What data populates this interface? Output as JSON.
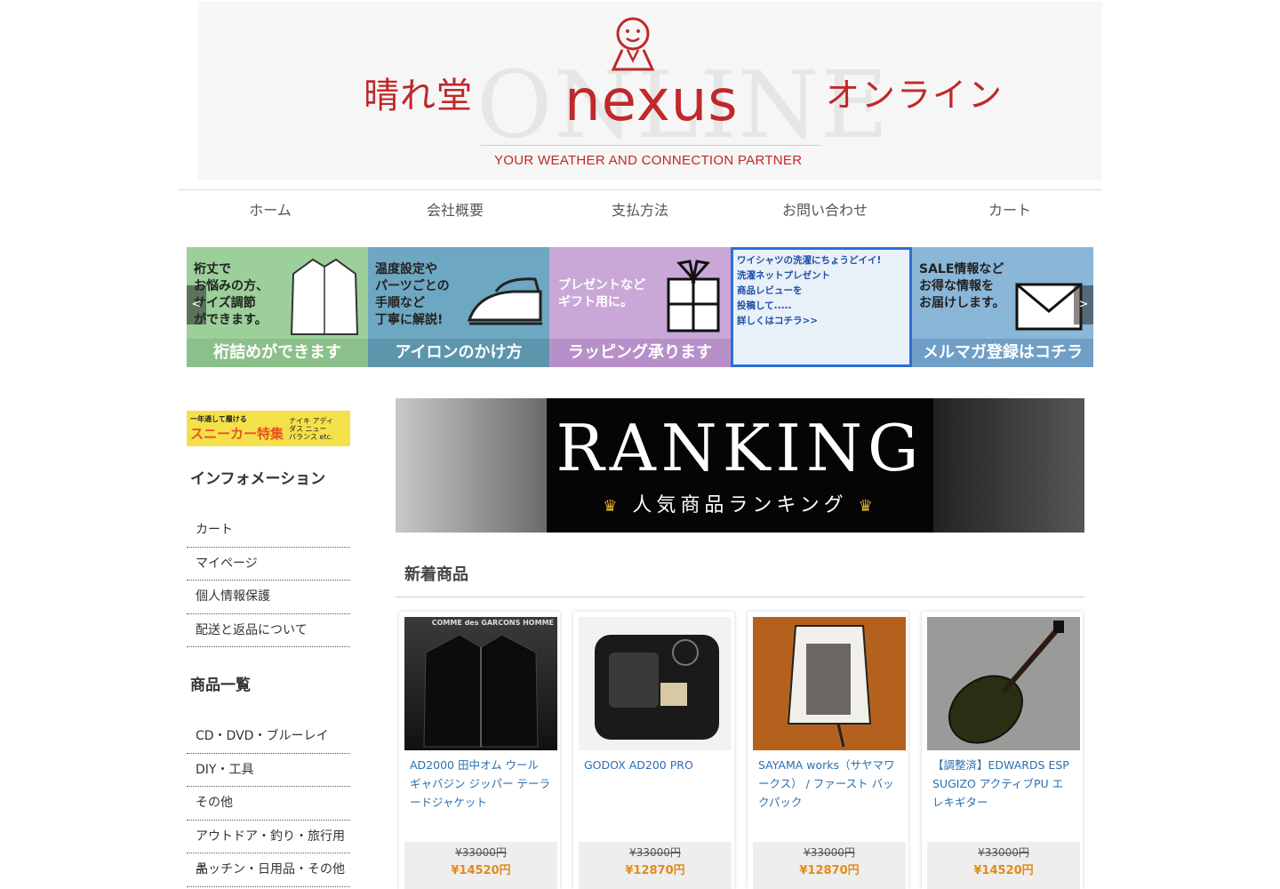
{
  "header": {
    "brand_left": "晴れ堂",
    "brand_main": "nexus",
    "brand_right": "オンライン",
    "ghost_text": "ONLINE",
    "tagline": "YOUR WEATHER AND CONNECTION PARTNER"
  },
  "nav": [
    "ホーム",
    "会社概要",
    "支払方法",
    "お問い合わせ",
    "カート"
  ],
  "carousel": [
    {
      "text": "裄丈で\nお悩みの方、\nサイズ調節\nができます。",
      "caption": "裄詰めができます"
    },
    {
      "text": "温度設定や\nパーツごとの\n手順など\n丁寧に解説!",
      "caption": "アイロンのかけ方"
    },
    {
      "text": "プレゼントなど\nギフト用に。",
      "caption": "ラッピング承ります"
    },
    {
      "text": "ワイシャツの洗濯にちょうどイイ!\n洗濯ネットプレゼント\n商品レビューを\n投稿して.....\n詳しくはコチラ>>",
      "caption": ""
    },
    {
      "text": "SALE情報など\nお得な情報を\nお届けします。",
      "caption": "メルマガ登録はコチラ"
    }
  ],
  "carousel_nav": {
    "prev": "<",
    "next": ">"
  },
  "sidebar": {
    "banner_main": "スニーカー特集",
    "banner_top": "一年通して履ける",
    "banner_sub": "ナイキ アディダス ニューバランス etc.",
    "info_heading": "インフォメーション",
    "info_links": [
      "カート",
      "マイページ",
      "個人情報保護",
      "配送と返品について"
    ],
    "category_heading": "商品一覧",
    "categories": [
      "CD・DVD・ブルーレイ",
      "DIY・工具",
      "その他",
      "アウトドア・釣り・旅行用品",
      "キッチン・日用品・その他"
    ]
  },
  "ranking": {
    "title": "RANKING",
    "subtitle": "人気商品ランキング"
  },
  "new_items": {
    "title": "新着商品",
    "products": [
      {
        "name": "AD2000 田中オム ウール ギャバジン ジッパー テーラードジャケット",
        "old_price": "¥33000円",
        "price": "¥14520円",
        "thumb_label": "COMME des GARCONS HOMME"
      },
      {
        "name": "GODOX AD200 PRO",
        "old_price": "¥33000円",
        "price": "¥12870円",
        "thumb_label": ""
      },
      {
        "name": "SAYAMA works（サヤマワークス） / ファースト バックパック",
        "old_price": "¥33000円",
        "price": "¥12870円",
        "thumb_label": ""
      },
      {
        "name": "【調整済】EDWARDS ESP SUGIZO アクティブPU エレキギター",
        "old_price": "¥33000円",
        "price": "¥14520円",
        "thumb_label": ""
      }
    ]
  },
  "colors": {
    "brand_red": "#c0282a",
    "link_blue": "#2a6fb0",
    "price_orange": "#e38a1a"
  }
}
